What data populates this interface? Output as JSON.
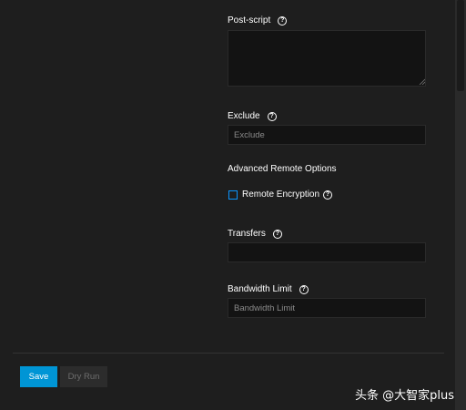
{
  "form": {
    "post_script": {
      "label": "Post-script",
      "value": ""
    },
    "exclude": {
      "label": "Exclude",
      "placeholder": "Exclude",
      "value": ""
    },
    "advanced_heading": "Advanced Remote Options",
    "remote_encryption": {
      "label": "Remote Encryption",
      "checked": false
    },
    "transfers": {
      "label": "Transfers",
      "value": ""
    },
    "bandwidth_limit": {
      "label": "Bandwidth Limit",
      "placeholder": "Bandwidth Limit",
      "value": ""
    }
  },
  "help_glyph": "?",
  "actions": {
    "save_label": "Save",
    "dry_run_label": "Dry Run"
  },
  "watermark": "头条 @大智家plus",
  "colors": {
    "background": "#1e1e1e",
    "field": "#131313",
    "primary": "#0095d5",
    "checkbox_border": "#0a95ff"
  }
}
